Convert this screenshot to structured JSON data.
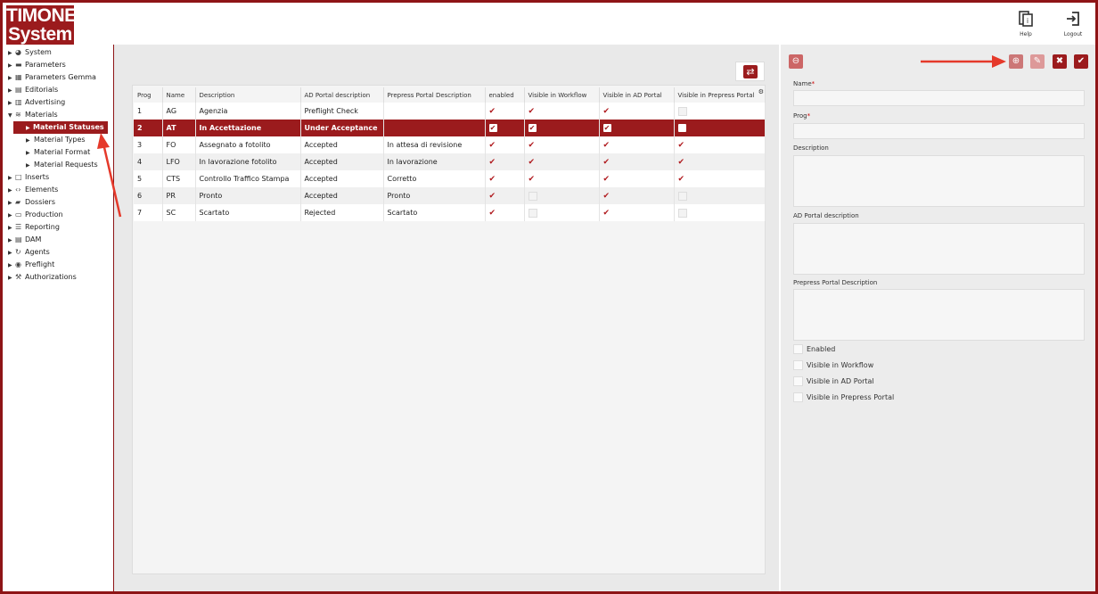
{
  "app": {
    "logo_line1": "TIMONE",
    "logo_line2": "System",
    "help_label": "Help",
    "logout_label": "Logout",
    "accent_color": "#9b1b1d"
  },
  "sidebar": {
    "items": [
      {
        "label": "System",
        "icon": "dashboard-icon"
      },
      {
        "label": "Parameters",
        "icon": "briefcase-icon"
      },
      {
        "label": "Parameters Gemma",
        "icon": "building-icon"
      },
      {
        "label": "Editorials",
        "icon": "document-icon"
      },
      {
        "label": "Advertising",
        "icon": "chart-icon"
      },
      {
        "label": "Materials",
        "icon": "layers-icon",
        "expanded": true
      },
      {
        "label": "Inserts",
        "icon": "book-icon"
      },
      {
        "label": "Elements",
        "icon": "code-icon"
      },
      {
        "label": "Dossiers",
        "icon": "folder-icon"
      },
      {
        "label": "Production",
        "icon": "printer-icon"
      },
      {
        "label": "Reporting",
        "icon": "list-icon"
      },
      {
        "label": "DAM",
        "icon": "database-icon"
      },
      {
        "label": "Agents",
        "icon": "refresh-icon"
      },
      {
        "label": "Preflight",
        "icon": "eye-icon"
      },
      {
        "label": "Authorizations",
        "icon": "wrench-icon"
      }
    ],
    "material_children": [
      {
        "label": "Material Statuses",
        "active": true
      },
      {
        "label": "Material Types"
      },
      {
        "label": "Material Format"
      },
      {
        "label": "Material Requests"
      }
    ]
  },
  "table": {
    "headers": [
      "Prog",
      "Name",
      "Description",
      "AD Portal description",
      "Prepress Portal Description",
      "enabled",
      "Visible in Workflow",
      "Visible in AD Portal",
      "Visible in Prepress Portal"
    ],
    "rows": [
      {
        "prog": "1",
        "name": "AG",
        "description": "Agenzia",
        "ad": "Preflight Check",
        "prepress": "",
        "enabled": true,
        "workflow": true,
        "adportal": true,
        "prepressportal": false,
        "selected": false
      },
      {
        "prog": "2",
        "name": "AT",
        "description": "In Accettazione",
        "ad": "Under Acceptance",
        "prepress": "",
        "enabled": true,
        "workflow": true,
        "adportal": true,
        "prepressportal": false,
        "selected": true
      },
      {
        "prog": "3",
        "name": "FO",
        "description": "Assegnato a fotolito",
        "ad": "Accepted",
        "prepress": "In attesa di revisione",
        "enabled": true,
        "workflow": true,
        "adportal": true,
        "prepressportal": true,
        "selected": false
      },
      {
        "prog": "4",
        "name": "LFO",
        "description": "In lavorazione fotolito",
        "ad": "Accepted",
        "prepress": "In lavorazione",
        "enabled": true,
        "workflow": true,
        "adportal": true,
        "prepressportal": true,
        "selected": false
      },
      {
        "prog": "5",
        "name": "CTS",
        "description": "Controllo Traffico Stampa",
        "ad": "Accepted",
        "prepress": "Corretto",
        "enabled": true,
        "workflow": true,
        "adportal": true,
        "prepressportal": true,
        "selected": false
      },
      {
        "prog": "6",
        "name": "PR",
        "description": "Pronto",
        "ad": "Accepted",
        "prepress": "Pronto",
        "enabled": true,
        "workflow": false,
        "adportal": true,
        "prepressportal": false,
        "selected": false
      },
      {
        "prog": "7",
        "name": "SC",
        "description": "Scartato",
        "ad": "Rejected",
        "prepress": "Scartato",
        "enabled": true,
        "workflow": false,
        "adportal": true,
        "prepressportal": false,
        "selected": false
      }
    ]
  },
  "form": {
    "name_label": "Name",
    "prog_label": "Prog",
    "description_label": "Description",
    "ad_label": "AD Portal description",
    "prepress_label": "Prepress Portal Description",
    "required_mark": "*",
    "checkboxes": [
      "Enabled",
      "Visible in Workflow",
      "Visible in AD Portal",
      "Visible in Prepress Portal"
    ]
  }
}
